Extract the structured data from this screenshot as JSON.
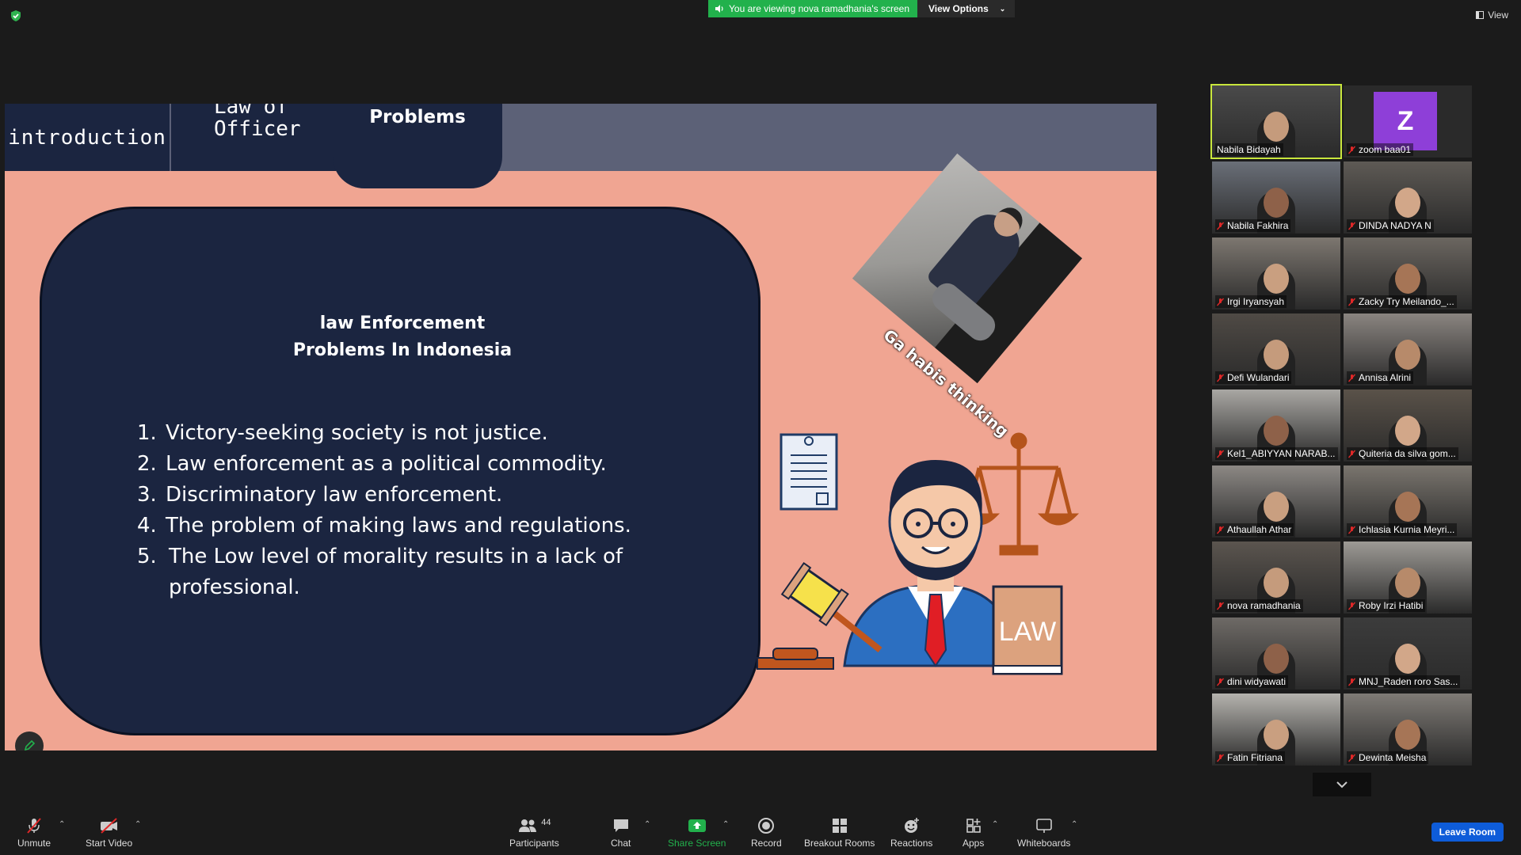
{
  "banner": {
    "viewing_text": "You are viewing nova ramadhania's screen",
    "view_options_label": "View Options"
  },
  "view_button_label": "View",
  "slide": {
    "tabs": {
      "intro": "introduction",
      "law_line1": "Law of",
      "law_line2": "Officer",
      "problems": "Problems"
    },
    "title_line1": "law Enforcement",
    "title_line2": "Problems In Indonesia",
    "items": [
      {
        "num": "1.",
        "text": "Victory-seeking society is not justice."
      },
      {
        "num": "2.",
        "text": "Law enforcement as a political commodity."
      },
      {
        "num": "3.",
        "text": "Discriminatory law enforcement."
      },
      {
        "num": "4.",
        "text": "The problem of making laws and regulations."
      },
      {
        "num": "5.",
        "text": "The Low level of morality results in a lack of professional."
      }
    ],
    "meme_caption": "Ga habis thinking",
    "law_book_label": "LAW"
  },
  "participants": [
    {
      "name": "Nabila Bidayah",
      "muted": false,
      "active": true
    },
    {
      "name": "zoom baa01",
      "muted": true,
      "avatar_letter": "Z"
    },
    {
      "name": "Nabila Fakhira",
      "muted": true
    },
    {
      "name": "DINDA NADYA N",
      "muted": true
    },
    {
      "name": "Irgi Iryansyah",
      "muted": true
    },
    {
      "name": "Zacky Try Meilando_...",
      "muted": true
    },
    {
      "name": "Defi Wulandari",
      "muted": true
    },
    {
      "name": "Annisa Alrini",
      "muted": true
    },
    {
      "name": "Kel1_ABIYYAN NARAB...",
      "muted": true
    },
    {
      "name": "Quiteria da silva gom...",
      "muted": true
    },
    {
      "name": "Athaullah Athar",
      "muted": true
    },
    {
      "name": "Ichlasia Kurnia Meyri...",
      "muted": true
    },
    {
      "name": "nova ramadhania",
      "muted": true
    },
    {
      "name": "Roby Irzi Hatibi",
      "muted": true
    },
    {
      "name": "dini widyawati",
      "muted": true
    },
    {
      "name": "MNJ_Raden roro Sas...",
      "muted": true
    },
    {
      "name": "Fatin Fitriana",
      "muted": true
    },
    {
      "name": "Dewinta Meisha",
      "muted": true
    }
  ],
  "toolbar": {
    "unmute": "Unmute",
    "start_video": "Start Video",
    "participants": "Participants",
    "participants_count": "44",
    "chat": "Chat",
    "share_screen": "Share Screen",
    "record": "Record",
    "breakout_rooms": "Breakout Rooms",
    "reactions": "Reactions",
    "apps": "Apps",
    "whiteboards": "Whiteboards",
    "leave_room": "Leave Room"
  },
  "colors": {
    "accent_green": "#22b14c",
    "leave_blue": "#0e5cd9",
    "slide_bg": "#f0a592",
    "slide_card": "#1b2540",
    "active_speaker": "#c8e63c"
  }
}
